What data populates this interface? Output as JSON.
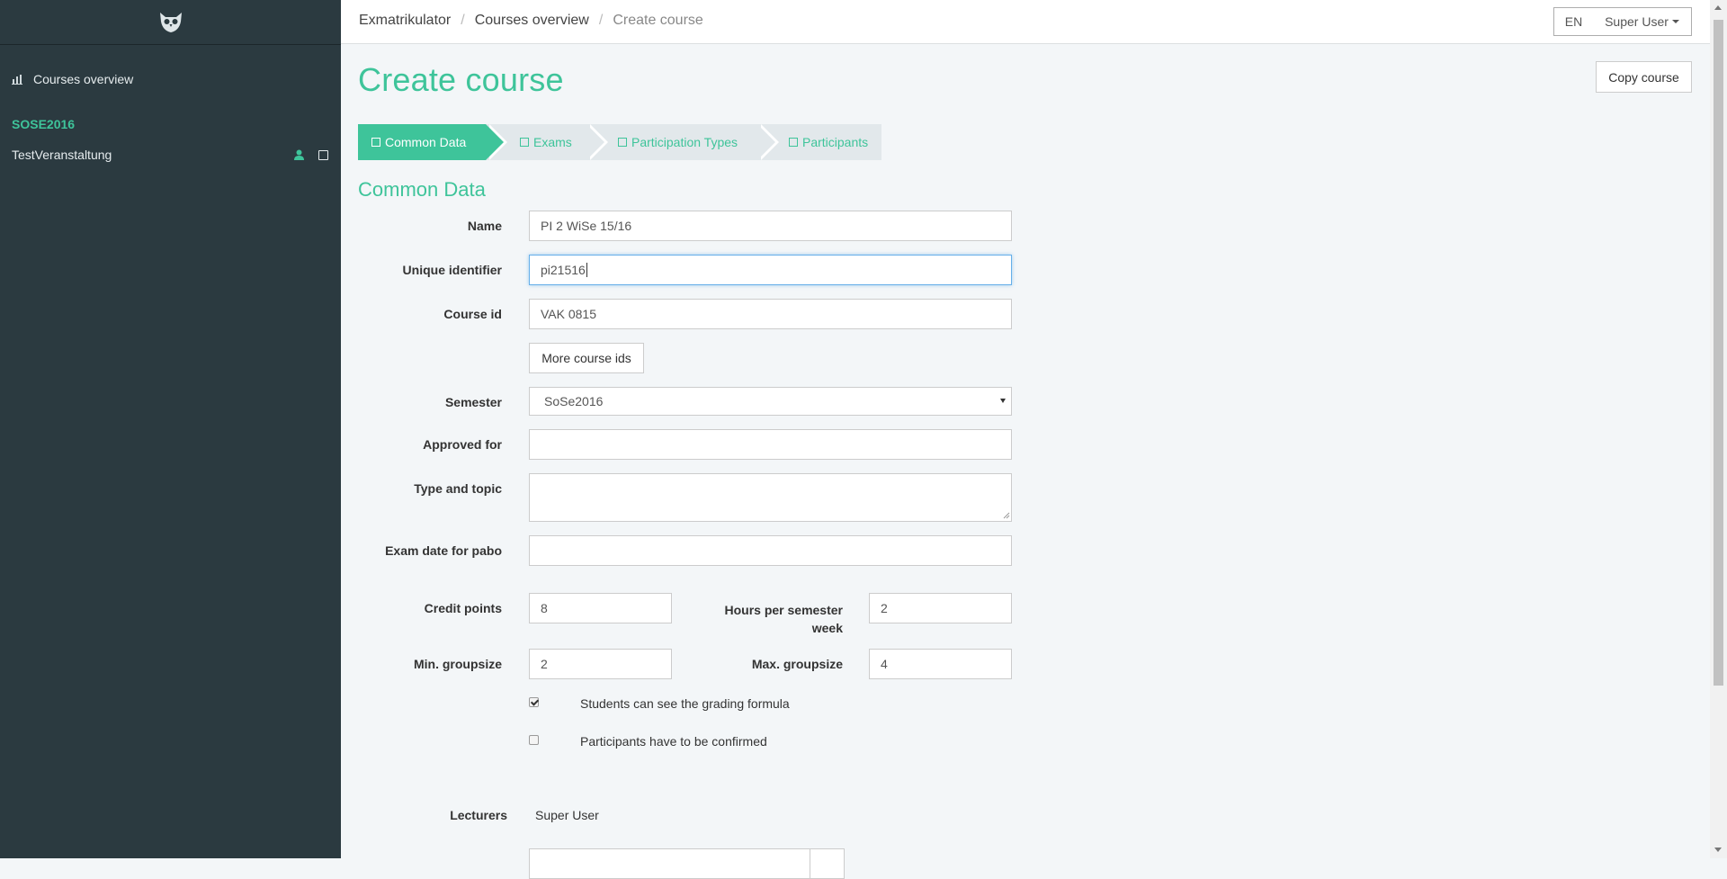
{
  "sidebar": {
    "nav": {
      "label": "Courses overview",
      "icon": "chart-icon"
    },
    "semester": "SOSE2016",
    "course": {
      "label": "TestVeranstaltung",
      "icon1": "user-icon",
      "icon2": "square-icon"
    }
  },
  "topbar": {
    "breadcrumb": [
      "Exmatrikulator",
      "Courses overview",
      "Create course"
    ],
    "language": "EN",
    "user_menu": "Super User"
  },
  "page": {
    "title": "Create course",
    "copy_button": "Copy course",
    "wizard": [
      {
        "label": "Common Data",
        "active": true
      },
      {
        "label": "Exams",
        "active": false
      },
      {
        "label": "Participation Types",
        "active": false
      },
      {
        "label": "Participants",
        "active": false
      }
    ],
    "section_title": "Common Data"
  },
  "form": {
    "name": {
      "label": "Name",
      "value": "PI 2 WiSe 15/16"
    },
    "unique_identifier": {
      "label": "Unique identifier",
      "value": "pi21516"
    },
    "course_id": {
      "label": "Course id",
      "value": "VAK 0815"
    },
    "more_ids_button": "More course ids",
    "semester": {
      "label": "Semester",
      "value": "SoSe2016"
    },
    "approved_for": {
      "label": "Approved for",
      "value": ""
    },
    "type_topic": {
      "label": "Type and topic",
      "value": ""
    },
    "exam_date": {
      "label": "Exam date for pabo",
      "value": ""
    },
    "credit_points": {
      "label": "Credit points",
      "value": "8"
    },
    "hours_per_week": {
      "label_line1": "Hours per semester",
      "label_line2": "week",
      "value": "2"
    },
    "min_groupsize": {
      "label": "Min. groupsize",
      "value": "2"
    },
    "max_groupsize": {
      "label": "Max. groupsize",
      "value": "4"
    },
    "grading_formula": {
      "label": "Students can see the grading formula",
      "checked": true
    },
    "confirm_participants": {
      "label": "Participants have to be confirmed",
      "checked": false
    },
    "lecturers": {
      "label": "Lecturers",
      "value": "Super User"
    }
  }
}
